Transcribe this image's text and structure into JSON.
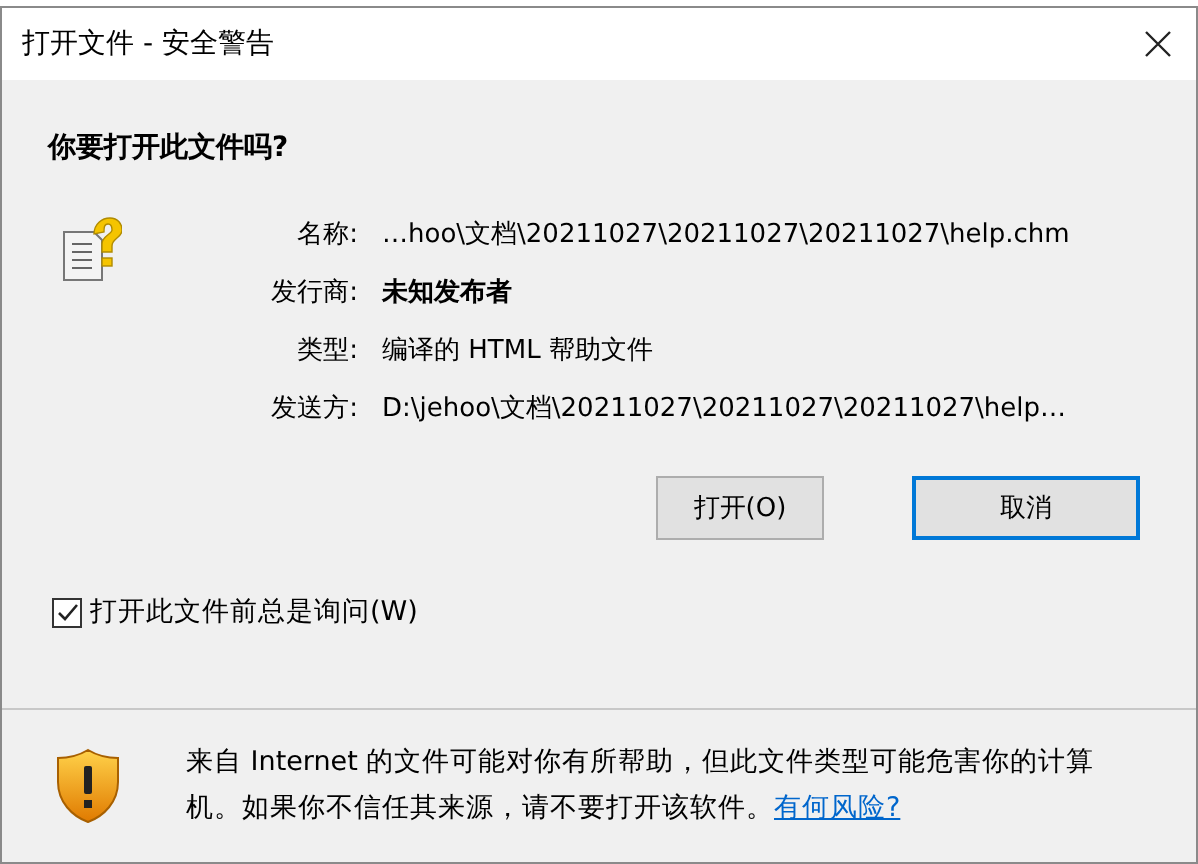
{
  "window": {
    "title": "打开文件 - 安全警告"
  },
  "question": "你要打开此文件吗?",
  "fields": [
    {
      "label": "名称:",
      "value": "…hoo\\文档\\20211027\\20211027\\20211027\\help.chm",
      "bold": false
    },
    {
      "label": "发行商:",
      "value": "未知发布者",
      "bold": true
    },
    {
      "label": "类型:",
      "value": "编译的 HTML 帮助文件",
      "bold": false
    },
    {
      "label": "发送方:",
      "value": "D:\\jehoo\\文档\\20211027\\20211027\\20211027\\help…",
      "bold": false
    }
  ],
  "buttons": [
    {
      "label": "打开(O)",
      "focused": false
    },
    {
      "label": "取消",
      "focused": true
    }
  ],
  "checkbox": {
    "label": "打开此文件前总是询问(W)",
    "checked": true
  },
  "warning": {
    "text": "来自 Internet 的文件可能对你有所帮助，但此文件类型可能危害你的计算机。如果你不信任其来源，请不要打开该软件。",
    "link": "有何风险?"
  }
}
